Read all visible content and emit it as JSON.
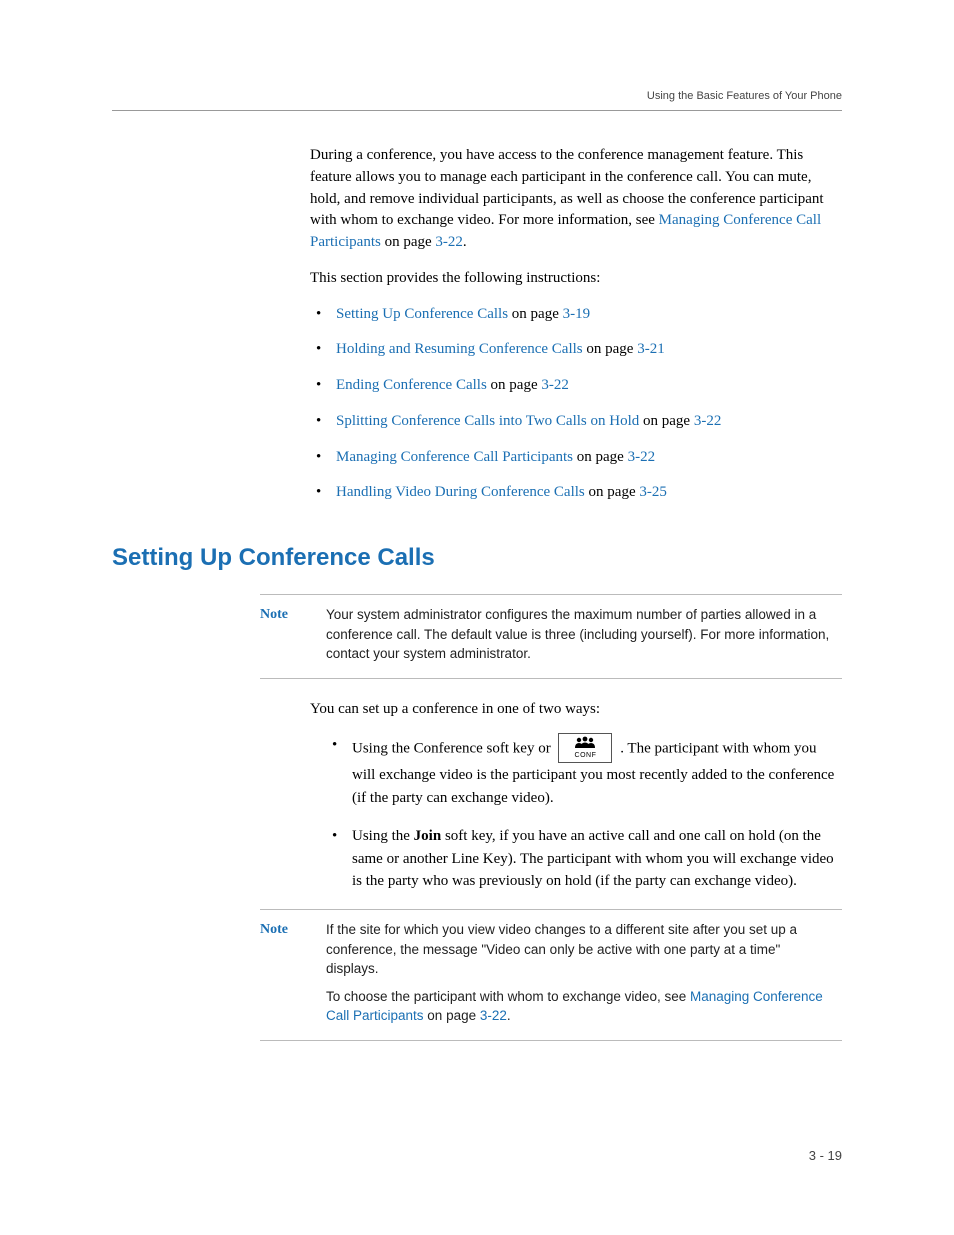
{
  "runningHead": "Using the Basic Features of Your Phone",
  "intro": {
    "p1_a": "During a conference, you have access to the conference management feature. This feature allows you to manage each participant in the conference call. You can mute, hold, and remove individual participants, as well as choose the conference participant with whom to exchange video. For more information, see ",
    "p1_link": "Managing Conference Call Participants",
    "p1_b": " on page ",
    "p1_page": "3-22",
    "p1_c": ".",
    "p2": "This section provides the following instructions:"
  },
  "toc": [
    {
      "link": "Setting Up Conference Calls",
      "mid": " on page ",
      "page": "3-19"
    },
    {
      "link": "Holding and Resuming Conference Calls",
      "mid": " on page ",
      "page": "3-21"
    },
    {
      "link": "Ending Conference Calls",
      "mid": " on page ",
      "page": "3-22"
    },
    {
      "link": "Splitting Conference Calls into Two Calls on Hold",
      "mid": " on page ",
      "page": "3-22"
    },
    {
      "link": "Managing Conference Call Participants",
      "mid": " on page ",
      "page": "3-22"
    },
    {
      "link": "Handling Video During Conference Calls",
      "mid": " on page ",
      "page": "3-25"
    }
  ],
  "heading": "Setting Up Conference Calls",
  "note1": {
    "label": "Note",
    "text": "Your system administrator configures the maximum number of parties allowed in a conference call. The default value is three (including yourself). For more information, contact your system administrator."
  },
  "setup": {
    "intro": "You can set up a conference in one of two ways:",
    "b1_a": "Using the Conference soft key or ",
    "b1_icon_label": "CONF",
    "b1_b": " . The participant with whom you will exchange video is the participant you most recently added to the conference (if the party can exchange video).",
    "b2_a": "Using the ",
    "b2_bold": "Join",
    "b2_b": " soft key, if you have an active call and one call on hold (on the same or another Line Key). The participant with whom you will exchange video is the party who was previously on hold (if the party can exchange video)."
  },
  "note2": {
    "label": "Note",
    "p1": "If the site for which you view video changes to a different site after you set up a conference, the message \"Video can only be active with one party at a time\" displays.",
    "p2_a": "To choose the participant with whom to exchange video, see ",
    "p2_link": "Managing Conference Call Participants",
    "p2_b": " on page ",
    "p2_page": "3-22",
    "p2_c": "."
  },
  "footer": "3 - 19"
}
